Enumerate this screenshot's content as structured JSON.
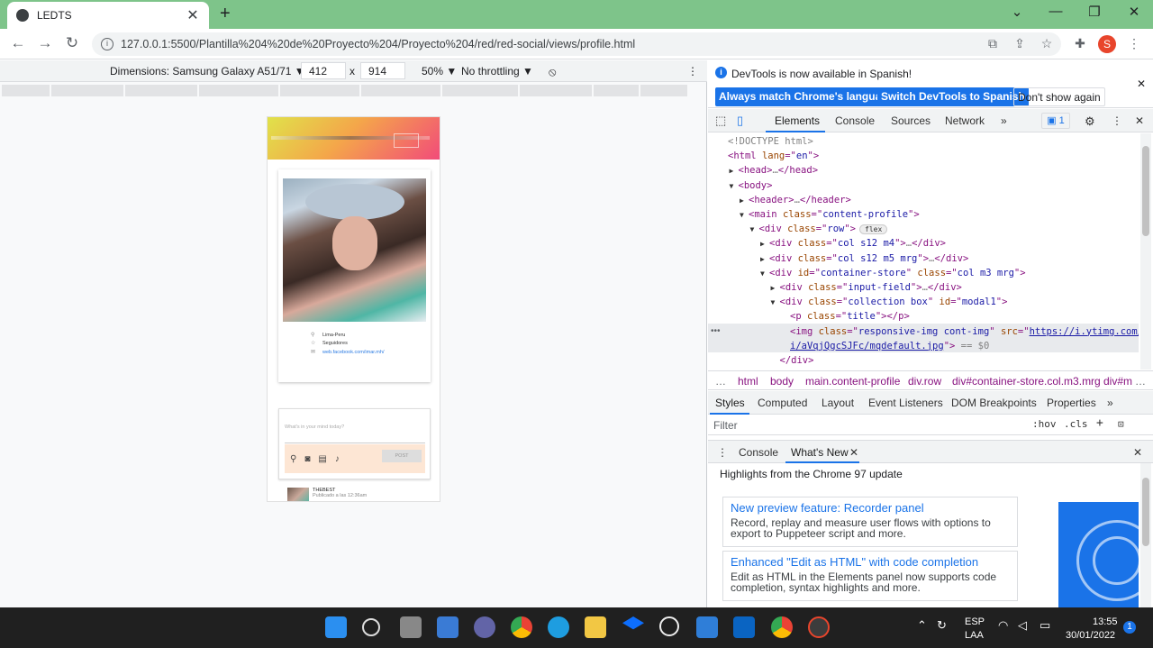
{
  "browser": {
    "tab_title": "LEDTS",
    "url": "127.0.0.1:5500/Plantilla%204%20de%20Proyecto%204/Proyecto%204/red/red-social/views/profile.html",
    "profile_initial": "S"
  },
  "device_toolbar": {
    "device": "Dimensions: Samsung Galaxy A51/71 ▼",
    "width": "412",
    "times": "x",
    "height": "914",
    "zoom": "50% ▼",
    "throttling": "No throttling ▼"
  },
  "page": {
    "profile_items": [
      {
        "icon": "map-pin-icon",
        "text": "Lima-Peru"
      },
      {
        "icon": "star-icon",
        "text": "Seguidores"
      },
      {
        "icon": "mail-icon",
        "text": "web.facebook.com/imar.mh/"
      }
    ],
    "post_placeholder": "What's in your mind today?",
    "post_button": "POST",
    "feed_user": "THEBEST",
    "feed_time": "Publicado a las 12:36am"
  },
  "devtools": {
    "info_message": "DevTools is now available in Spanish!",
    "info_buttons": [
      "Always match Chrome's language",
      "Switch DevTools to Spanish",
      "Don't show again"
    ],
    "tabs": [
      "Elements",
      "Console",
      "Sources",
      "Network",
      "»"
    ],
    "issues_count": "1",
    "tree": [
      {
        "indent": 0,
        "arrow": "",
        "parts": [
          [
            "cm",
            "<!DOCTYPE html>"
          ]
        ]
      },
      {
        "indent": 0,
        "arrow": "",
        "parts": [
          [
            "tg",
            "<html "
          ],
          [
            "an",
            "lang"
          ],
          [
            "tg",
            "=\""
          ],
          [
            "av",
            "en"
          ],
          [
            "tg",
            "\">"
          ]
        ]
      },
      {
        "indent": 1,
        "arrow": "▶",
        "parts": [
          [
            "tg",
            "<head>"
          ],
          [
            "cm",
            "…"
          ],
          [
            "tg",
            "</head>"
          ]
        ]
      },
      {
        "indent": 1,
        "arrow": "▼",
        "parts": [
          [
            "tg",
            "<body>"
          ]
        ]
      },
      {
        "indent": 2,
        "arrow": "▶",
        "parts": [
          [
            "tg",
            "<header>"
          ],
          [
            "cm",
            "…"
          ],
          [
            "tg",
            "</header>"
          ]
        ]
      },
      {
        "indent": 2,
        "arrow": "▼",
        "parts": [
          [
            "tg",
            "<main "
          ],
          [
            "an",
            "class"
          ],
          [
            "tg",
            "=\""
          ],
          [
            "av",
            "content-profile"
          ],
          [
            "tg",
            "\">"
          ]
        ]
      },
      {
        "indent": 3,
        "arrow": "▼",
        "parts": [
          [
            "tg",
            "<div "
          ],
          [
            "an",
            "class"
          ],
          [
            "tg",
            "=\""
          ],
          [
            "av",
            "row"
          ],
          [
            "tg",
            "\">"
          ]
        ],
        "badge": "flex"
      },
      {
        "indent": 4,
        "arrow": "▶",
        "parts": [
          [
            "tg",
            "<div "
          ],
          [
            "an",
            "class"
          ],
          [
            "tg",
            "=\""
          ],
          [
            "av",
            "col s12 m4"
          ],
          [
            "tg",
            "\">"
          ],
          [
            "cm",
            "…"
          ],
          [
            "tg",
            "</div>"
          ]
        ]
      },
      {
        "indent": 4,
        "arrow": "▶",
        "parts": [
          [
            "tg",
            "<div "
          ],
          [
            "an",
            "class"
          ],
          [
            "tg",
            "=\""
          ],
          [
            "av",
            "col s12 m5 mrg"
          ],
          [
            "tg",
            "\">"
          ],
          [
            "cm",
            "…"
          ],
          [
            "tg",
            "</div>"
          ]
        ]
      },
      {
        "indent": 4,
        "arrow": "▼",
        "parts": [
          [
            "tg",
            "<div "
          ],
          [
            "an",
            "id"
          ],
          [
            "tg",
            "=\""
          ],
          [
            "av",
            "container-store"
          ],
          [
            "tg",
            "\" "
          ],
          [
            "an",
            "class"
          ],
          [
            "tg",
            "=\""
          ],
          [
            "av",
            "col m3 mrg"
          ],
          [
            "tg",
            "\">"
          ]
        ]
      },
      {
        "indent": 5,
        "arrow": "▶",
        "parts": [
          [
            "tg",
            "<div "
          ],
          [
            "an",
            "class"
          ],
          [
            "tg",
            "=\""
          ],
          [
            "av",
            "input-field"
          ],
          [
            "tg",
            "\">"
          ],
          [
            "cm",
            "…"
          ],
          [
            "tg",
            "</div>"
          ]
        ]
      },
      {
        "indent": 5,
        "arrow": "▼",
        "parts": [
          [
            "tg",
            "<div "
          ],
          [
            "an",
            "class"
          ],
          [
            "tg",
            "=\""
          ],
          [
            "av",
            "collection box"
          ],
          [
            "tg",
            "\" "
          ],
          [
            "an",
            "id"
          ],
          [
            "tg",
            "=\""
          ],
          [
            "av",
            "modal1"
          ],
          [
            "tg",
            "\">"
          ]
        ]
      },
      {
        "indent": 6,
        "arrow": "",
        "parts": [
          [
            "tg",
            "<p "
          ],
          [
            "an",
            "class"
          ],
          [
            "tg",
            "=\""
          ],
          [
            "av",
            "title"
          ],
          [
            "tg",
            "\"></p>"
          ]
        ]
      },
      {
        "indent": 6,
        "arrow": "",
        "parts": [
          [
            "tg",
            "<img "
          ],
          [
            "an",
            "class"
          ],
          [
            "tg",
            "=\""
          ],
          [
            "av",
            "responsive-img cont-img"
          ],
          [
            "tg",
            "\" "
          ],
          [
            "an",
            "src"
          ],
          [
            "tg",
            "=\""
          ],
          [
            "lnk",
            "https://i.ytimg.com/v"
          ]
        ]
      },
      {
        "indent": 6,
        "arrow": "",
        "parts": [
          [
            "lnk",
            "i/aVqjQgcSJFc/mqdefault.jpg"
          ],
          [
            "tg",
            "\">"
          ],
          [
            "cm",
            " == $0"
          ]
        ]
      },
      {
        "indent": 5,
        "arrow": "",
        "parts": [
          [
            "tg",
            "</div>"
          ]
        ]
      }
    ],
    "crumbs": [
      "…",
      "html",
      "body",
      "main.content-profile",
      "div.row",
      "div#container-store.col.m3.mrg",
      "div#m",
      "…"
    ],
    "styles_tabs": [
      "Styles",
      "Computed",
      "Layout",
      "Event Listeners",
      "DOM Breakpoints",
      "Properties",
      "»"
    ],
    "filter_placeholder": "Filter",
    "filter_hov": ":hov",
    "filter_cls": ".cls",
    "drawer_tabs": [
      "Console",
      "What's New"
    ],
    "whats_new_heading": "Highlights from the Chrome 97 update",
    "cards": [
      {
        "title": "New preview feature: Recorder panel",
        "body": "Record, replay and measure user flows with options to export to Puppeteer script and more."
      },
      {
        "title": "Enhanced \"Edit as HTML\" with code completion",
        "body": "Edit as HTML in the Elements panel now supports code completion, syntax highlights and more."
      }
    ]
  },
  "taskbar": {
    "lang1": "ESP",
    "lang2": "LAA",
    "time": "13:55",
    "date": "30/01/2022",
    "notif": "1"
  },
  "colors": {
    "tabstrip": "#7ec48a",
    "accent": "#1a73e8"
  }
}
